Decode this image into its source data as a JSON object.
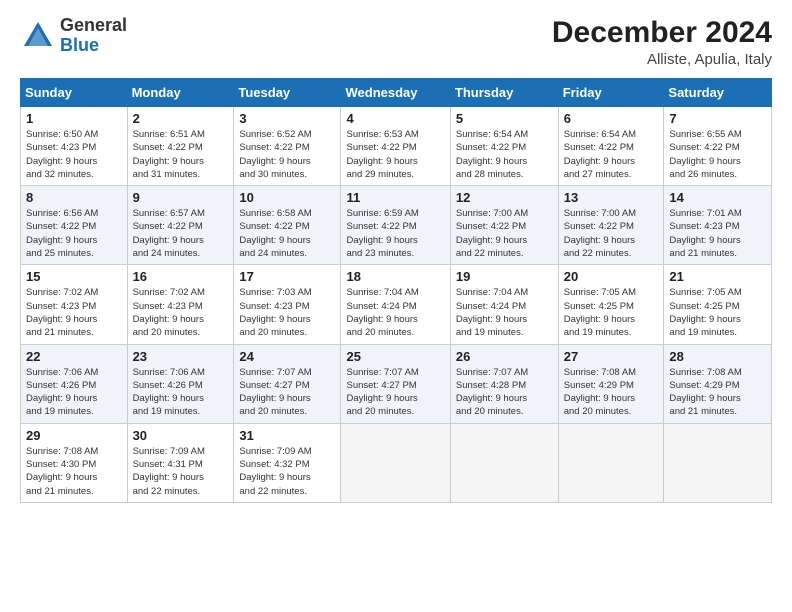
{
  "logo": {
    "general": "General",
    "blue": "Blue"
  },
  "title": "December 2024",
  "subtitle": "Alliste, Apulia, Italy",
  "headers": [
    "Sunday",
    "Monday",
    "Tuesday",
    "Wednesday",
    "Thursday",
    "Friday",
    "Saturday"
  ],
  "weeks": [
    [
      {
        "day": "1",
        "info": "Sunrise: 6:50 AM\nSunset: 4:23 PM\nDaylight: 9 hours\nand 32 minutes."
      },
      {
        "day": "2",
        "info": "Sunrise: 6:51 AM\nSunset: 4:22 PM\nDaylight: 9 hours\nand 31 minutes."
      },
      {
        "day": "3",
        "info": "Sunrise: 6:52 AM\nSunset: 4:22 PM\nDaylight: 9 hours\nand 30 minutes."
      },
      {
        "day": "4",
        "info": "Sunrise: 6:53 AM\nSunset: 4:22 PM\nDaylight: 9 hours\nand 29 minutes."
      },
      {
        "day": "5",
        "info": "Sunrise: 6:54 AM\nSunset: 4:22 PM\nDaylight: 9 hours\nand 28 minutes."
      },
      {
        "day": "6",
        "info": "Sunrise: 6:54 AM\nSunset: 4:22 PM\nDaylight: 9 hours\nand 27 minutes."
      },
      {
        "day": "7",
        "info": "Sunrise: 6:55 AM\nSunset: 4:22 PM\nDaylight: 9 hours\nand 26 minutes."
      }
    ],
    [
      {
        "day": "8",
        "info": "Sunrise: 6:56 AM\nSunset: 4:22 PM\nDaylight: 9 hours\nand 25 minutes."
      },
      {
        "day": "9",
        "info": "Sunrise: 6:57 AM\nSunset: 4:22 PM\nDaylight: 9 hours\nand 24 minutes."
      },
      {
        "day": "10",
        "info": "Sunrise: 6:58 AM\nSunset: 4:22 PM\nDaylight: 9 hours\nand 24 minutes."
      },
      {
        "day": "11",
        "info": "Sunrise: 6:59 AM\nSunset: 4:22 PM\nDaylight: 9 hours\nand 23 minutes."
      },
      {
        "day": "12",
        "info": "Sunrise: 7:00 AM\nSunset: 4:22 PM\nDaylight: 9 hours\nand 22 minutes."
      },
      {
        "day": "13",
        "info": "Sunrise: 7:00 AM\nSunset: 4:22 PM\nDaylight: 9 hours\nand 22 minutes."
      },
      {
        "day": "14",
        "info": "Sunrise: 7:01 AM\nSunset: 4:23 PM\nDaylight: 9 hours\nand 21 minutes."
      }
    ],
    [
      {
        "day": "15",
        "info": "Sunrise: 7:02 AM\nSunset: 4:23 PM\nDaylight: 9 hours\nand 21 minutes."
      },
      {
        "day": "16",
        "info": "Sunrise: 7:02 AM\nSunset: 4:23 PM\nDaylight: 9 hours\nand 20 minutes."
      },
      {
        "day": "17",
        "info": "Sunrise: 7:03 AM\nSunset: 4:23 PM\nDaylight: 9 hours\nand 20 minutes."
      },
      {
        "day": "18",
        "info": "Sunrise: 7:04 AM\nSunset: 4:24 PM\nDaylight: 9 hours\nand 20 minutes."
      },
      {
        "day": "19",
        "info": "Sunrise: 7:04 AM\nSunset: 4:24 PM\nDaylight: 9 hours\nand 19 minutes."
      },
      {
        "day": "20",
        "info": "Sunrise: 7:05 AM\nSunset: 4:25 PM\nDaylight: 9 hours\nand 19 minutes."
      },
      {
        "day": "21",
        "info": "Sunrise: 7:05 AM\nSunset: 4:25 PM\nDaylight: 9 hours\nand 19 minutes."
      }
    ],
    [
      {
        "day": "22",
        "info": "Sunrise: 7:06 AM\nSunset: 4:26 PM\nDaylight: 9 hours\nand 19 minutes."
      },
      {
        "day": "23",
        "info": "Sunrise: 7:06 AM\nSunset: 4:26 PM\nDaylight: 9 hours\nand 19 minutes."
      },
      {
        "day": "24",
        "info": "Sunrise: 7:07 AM\nSunset: 4:27 PM\nDaylight: 9 hours\nand 20 minutes."
      },
      {
        "day": "25",
        "info": "Sunrise: 7:07 AM\nSunset: 4:27 PM\nDaylight: 9 hours\nand 20 minutes."
      },
      {
        "day": "26",
        "info": "Sunrise: 7:07 AM\nSunset: 4:28 PM\nDaylight: 9 hours\nand 20 minutes."
      },
      {
        "day": "27",
        "info": "Sunrise: 7:08 AM\nSunset: 4:29 PM\nDaylight: 9 hours\nand 20 minutes."
      },
      {
        "day": "28",
        "info": "Sunrise: 7:08 AM\nSunset: 4:29 PM\nDaylight: 9 hours\nand 21 minutes."
      }
    ],
    [
      {
        "day": "29",
        "info": "Sunrise: 7:08 AM\nSunset: 4:30 PM\nDaylight: 9 hours\nand 21 minutes."
      },
      {
        "day": "30",
        "info": "Sunrise: 7:09 AM\nSunset: 4:31 PM\nDaylight: 9 hours\nand 22 minutes."
      },
      {
        "day": "31",
        "info": "Sunrise: 7:09 AM\nSunset: 4:32 PM\nDaylight: 9 hours\nand 22 minutes."
      },
      null,
      null,
      null,
      null
    ]
  ]
}
